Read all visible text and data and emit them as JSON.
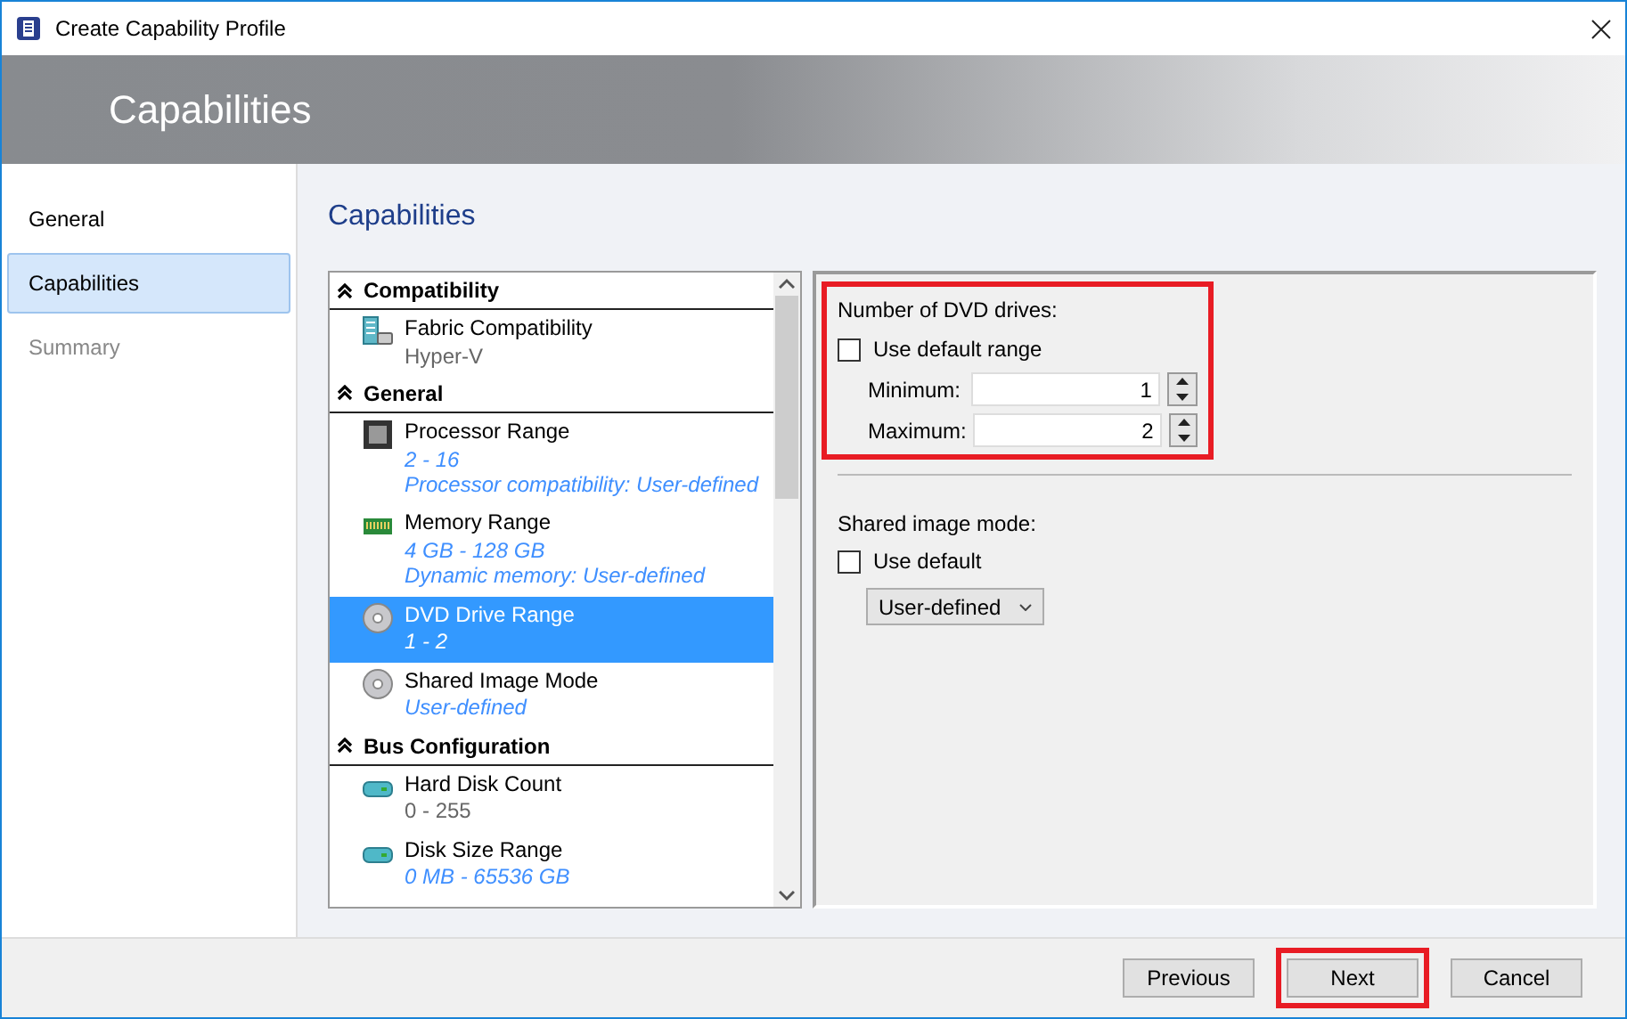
{
  "window": {
    "title": "Create Capability Profile"
  },
  "header": {
    "title": "Capabilities"
  },
  "nav": [
    {
      "label": "General",
      "selected": false,
      "disabled": false
    },
    {
      "label": "Capabilities",
      "selected": true,
      "disabled": false
    },
    {
      "label": "Summary",
      "selected": false,
      "disabled": true
    }
  ],
  "page_title": "Capabilities",
  "capability_list": [
    {
      "kind": "group",
      "label": "Compatibility",
      "expanded": true
    },
    {
      "kind": "server",
      "label": "Fabric Compatibility",
      "details": [
        "Hyper-V"
      ],
      "customized": false,
      "selected": false
    },
    {
      "kind": "group",
      "label": "General",
      "expanded": true
    },
    {
      "kind": "chip",
      "label": "Processor Range",
      "details": [
        "2 - 16",
        "Processor compatibility: User-defined"
      ],
      "customized": true,
      "selected": false
    },
    {
      "kind": "memory",
      "label": "Memory Range",
      "details": [
        "4  GB - 128  GB",
        "Dynamic memory: User-defined"
      ],
      "customized": true,
      "selected": false
    },
    {
      "kind": "disc",
      "label": "DVD Drive Range",
      "details": [
        "1 - 2"
      ],
      "customized": true,
      "selected": true
    },
    {
      "kind": "disc",
      "label": "Shared Image Mode",
      "details": [
        "User-defined"
      ],
      "customized": true,
      "selected": false
    },
    {
      "kind": "group",
      "label": "Bus Configuration",
      "expanded": true
    },
    {
      "kind": "disk",
      "label": "Hard Disk Count",
      "details": [
        "0 - 255"
      ],
      "customized": false,
      "selected": false
    },
    {
      "kind": "disk",
      "label": "Disk Size Range",
      "details": [
        "0 MB - 65536  GB"
      ],
      "customized": true,
      "selected": false
    }
  ],
  "dvd_drives": {
    "label": "Number of DVD drives:",
    "highlighted": true,
    "use_default": {
      "label": "Use default range",
      "checked": false
    },
    "minimum": {
      "label": "Minimum:",
      "value": "1"
    },
    "maximum": {
      "label": "Maximum:",
      "value": "2"
    }
  },
  "shared_image_mode": {
    "label": "Shared image mode:",
    "use_default": {
      "label": "Use default",
      "checked": false
    },
    "dropdown": "User-defined"
  },
  "buttons": [
    {
      "label": "Previous",
      "highlighted": false
    },
    {
      "label": "Next",
      "highlighted": true
    },
    {
      "label": "Cancel",
      "highlighted": false
    }
  ]
}
